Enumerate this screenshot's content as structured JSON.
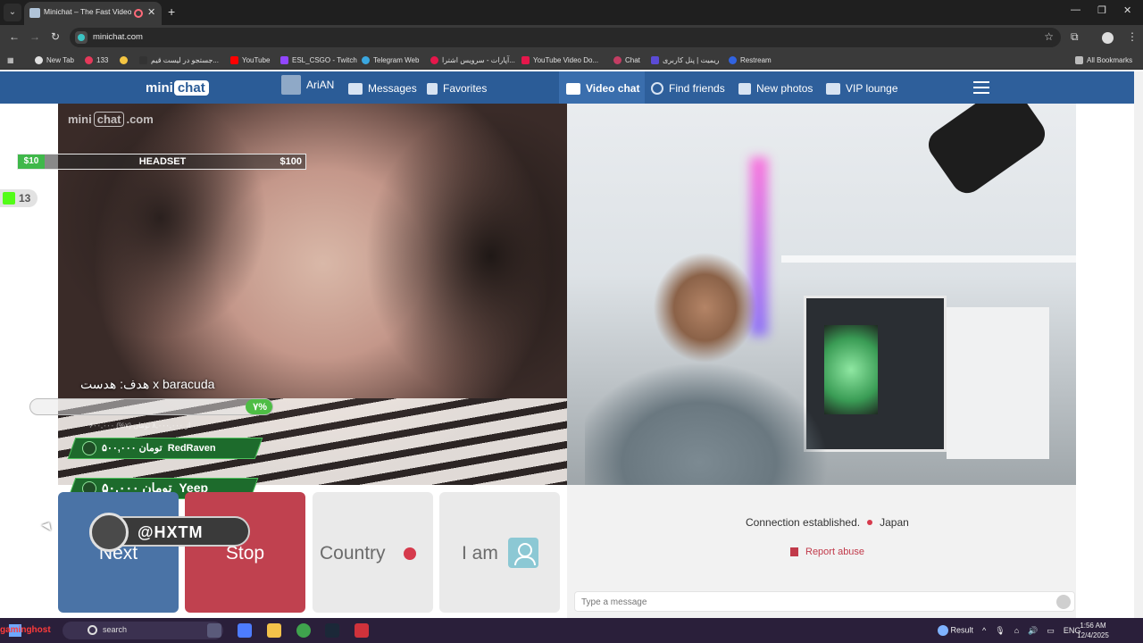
{
  "browser": {
    "tab_title": "Minichat – The Fast Video C",
    "url": "minichat.com",
    "bookmarks": [
      {
        "label": "New Tab",
        "icon": "globe-icon",
        "color": "#e0e0e0"
      },
      {
        "label": "133",
        "icon": "brand-icon",
        "color": "#e5395a"
      },
      {
        "label": "",
        "icon": "smile-icon",
        "color": "#f4c542"
      },
      {
        "label": "جستجو در لیست قیم...",
        "icon": "brand-icon",
        "color": "#333333"
      },
      {
        "label": "YouTube",
        "icon": "youtube-icon",
        "color": "#ff0000"
      },
      {
        "label": "ESL_CSGO - Twitch",
        "icon": "twitch-icon",
        "color": "#9146ff"
      },
      {
        "label": "Telegram Web",
        "icon": "telegram-icon",
        "color": "#3aa7e0"
      },
      {
        "label": "آپارات - سرویس اشترا...",
        "icon": "aparat-icon",
        "color": "#e5174b"
      },
      {
        "label": "YouTube Video Do...",
        "icon": "youtube-icon",
        "color": "#e5174b"
      },
      {
        "label": "Chat",
        "icon": "chat-icon",
        "color": "#c33d63"
      },
      {
        "label": "ریمیت | پنل کاربری",
        "icon": "remit-icon",
        "color": "#5b4bd6"
      },
      {
        "label": "Restream",
        "icon": "restream-icon",
        "color": "#3163e0"
      }
    ],
    "all_bookmarks": "All Bookmarks"
  },
  "site": {
    "logo_mini": "mini",
    "logo_chat": "chat",
    "nav_left": [
      {
        "label": "AriAN",
        "icon": "user-avatar-icon"
      },
      {
        "label": "Messages",
        "icon": "envelope-icon"
      },
      {
        "label": "Favorites",
        "icon": "bookmark-icon"
      }
    ],
    "nav_right": [
      {
        "label": "Video chat",
        "icon": "video-chat-icon"
      },
      {
        "label": "Find friends",
        "icon": "search-icon"
      },
      {
        "label": "New photos",
        "icon": "photos-icon"
      },
      {
        "label": "VIP lounge",
        "icon": "crown-icon"
      }
    ]
  },
  "overlay": {
    "watermark_left": "mini",
    "watermark_chat": "chat",
    "watermark_right": ".com",
    "goal_from": "$10",
    "goal_label": "HEADSET",
    "goal_to": "$100",
    "viewer_count": "13",
    "donation_goal": "هدف: هدست x baracuda",
    "donation_percent": "۷%",
    "donation_percent_value": 7,
    "progress_sub": "۶۰۰,۰۰۰ از ۸,۰۰۰,۰۰۰ تومان (۷%)",
    "alerts": [
      {
        "name": "RedRaven",
        "amount": "۵۰۰,۰۰۰ تومان"
      },
      {
        "name": "Yeep",
        "amount": "۵۰,۰۰۰ تومان"
      }
    ],
    "social_handle": "@HXTM"
  },
  "controls": {
    "next": "Next",
    "stop": "Stop",
    "country": "Country",
    "iam": "I am"
  },
  "status": {
    "connection": "Connection established.",
    "country": "Japan",
    "report": "Report abuse",
    "message_placeholder": "Type a message"
  },
  "taskbar": {
    "search_placeholder": "search",
    "overlay_text": "gaminghost",
    "weather": "Result",
    "lang": "ENG",
    "time": "1:56 AM",
    "date": "12/4/2025"
  }
}
